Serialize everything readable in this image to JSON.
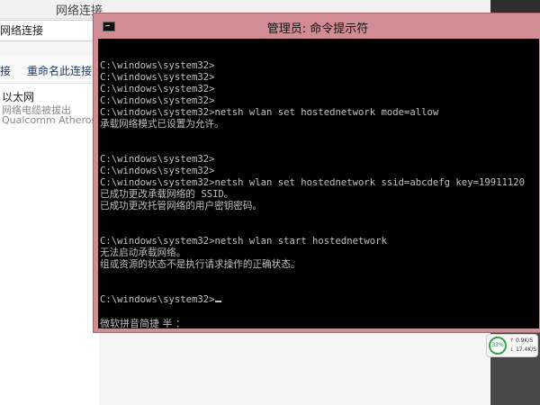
{
  "network_window": {
    "title": "网络连接",
    "address": "网络连接",
    "toolbar": {
      "item_left": "接",
      "rename": "重命名此连接"
    },
    "adapter": {
      "name": "以太网",
      "status": "网络电缆被拔出",
      "device": "Qualcomm Atheros A"
    }
  },
  "cmd_window": {
    "title": "管理员: 命令提示符",
    "console_text": "C:\\windows\\system32>\nC:\\windows\\system32>\nC:\\windows\\system32>\nC:\\windows\\system32>\nC:\\windows\\system32>netsh wlan set hostednetwork mode=allow\n承载网络模式已设置为允许。\n\n\nC:\\windows\\system32>\nC:\\windows\\system32>\nC:\\windows\\system32>netsh wlan set hostednetwork ssid=abcdefg key=19911120\n已成功更改承载网络的 SSID。\n已成功更改托管网络的用户密钥密码。\n\n\nC:\\windows\\system32>netsh wlan start hostednetwork\n无法启动承载网络。\n组或资源的状态不是执行请求操作的正确状态。\n\n\nC:\\windows\\system32>",
    "ime_status": "微软拼音简捷 半 ："
  },
  "speed_widget": {
    "percent": "33%",
    "upload": "0.9K/S",
    "download": "17.4K/S"
  },
  "colors": {
    "cmd_frame": "#d28d94",
    "console_bg": "#000000",
    "console_fg": "#c0c0c0"
  }
}
